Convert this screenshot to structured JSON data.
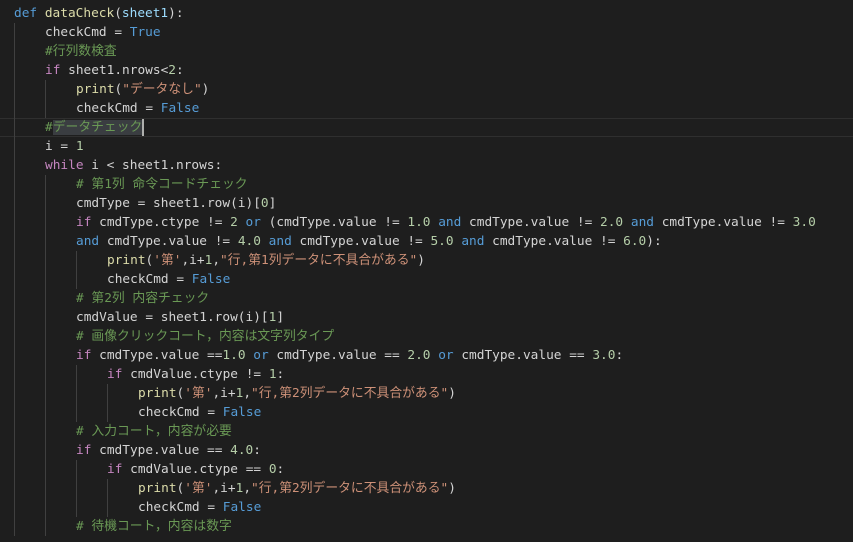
{
  "editor": {
    "theme_colors": {
      "background": "#1e1e1e",
      "keyword": "#569cd6",
      "control": "#c586c0",
      "function": "#dcdcaa",
      "parameter": "#9cdcfe",
      "string": "#ce9178",
      "number": "#b5cea8",
      "comment": "#6a9955",
      "text": "#d4d4d4"
    },
    "current_line": 7,
    "lines": [
      {
        "indent": 0,
        "tokens": [
          [
            "k",
            "def"
          ],
          [
            "t",
            " "
          ],
          [
            "f",
            "dataCheck"
          ],
          [
            "t",
            "("
          ],
          [
            "p",
            "sheet1"
          ],
          [
            "t",
            "):"
          ]
        ]
      },
      {
        "indent": 1,
        "tokens": [
          [
            "t",
            "checkCmd = "
          ],
          [
            "k",
            "True"
          ]
        ]
      },
      {
        "indent": 1,
        "tokens": [
          [
            "m",
            "#行列数検査"
          ]
        ]
      },
      {
        "indent": 1,
        "tokens": [
          [
            "c",
            "if"
          ],
          [
            "t",
            " sheet1.nrows<"
          ],
          [
            "n",
            "2"
          ],
          [
            "t",
            ":"
          ]
        ]
      },
      {
        "indent": 2,
        "tokens": [
          [
            "f",
            "print"
          ],
          [
            "t",
            "("
          ],
          [
            "s",
            "\"データなし\""
          ],
          [
            "t",
            ")"
          ]
        ]
      },
      {
        "indent": 2,
        "tokens": [
          [
            "t",
            "checkCmd = "
          ],
          [
            "k",
            "False"
          ]
        ]
      },
      {
        "indent": 1,
        "tokens": [
          [
            "m",
            "#"
          ],
          [
            "m sel",
            "データチェック"
          ]
        ],
        "cursor": true
      },
      {
        "indent": 1,
        "tokens": [
          [
            "t",
            "i = "
          ],
          [
            "n",
            "1"
          ]
        ]
      },
      {
        "indent": 1,
        "tokens": [
          [
            "c",
            "while"
          ],
          [
            "t",
            " i < sheet1.nrows:"
          ]
        ]
      },
      {
        "indent": 2,
        "tokens": [
          [
            "m",
            "# 第1列 命令コードチェック"
          ]
        ]
      },
      {
        "indent": 2,
        "tokens": [
          [
            "t",
            "cmdType = sheet1.row(i)["
          ],
          [
            "n",
            "0"
          ],
          [
            "t",
            "]"
          ]
        ]
      },
      {
        "indent": 2,
        "tokens": [
          [
            "c",
            "if"
          ],
          [
            "t",
            " cmdType.ctype != "
          ],
          [
            "n",
            "2"
          ],
          [
            "t",
            " "
          ],
          [
            "k",
            "or"
          ],
          [
            "t",
            " (cmdType.value != "
          ],
          [
            "n",
            "1.0"
          ],
          [
            "t",
            " "
          ],
          [
            "k",
            "and"
          ],
          [
            "t",
            " cmdType.value != "
          ],
          [
            "n",
            "2.0"
          ],
          [
            "t",
            " "
          ],
          [
            "k",
            "and"
          ],
          [
            "t",
            " cmdType.value != "
          ],
          [
            "n",
            "3.0"
          ]
        ]
      },
      {
        "indent": 2,
        "tokens": [
          [
            "k",
            "and"
          ],
          [
            "t",
            " cmdType.value != "
          ],
          [
            "n",
            "4.0"
          ],
          [
            "t",
            " "
          ],
          [
            "k",
            "and"
          ],
          [
            "t",
            " cmdType.value != "
          ],
          [
            "n",
            "5.0"
          ],
          [
            "t",
            " "
          ],
          [
            "k",
            "and"
          ],
          [
            "t",
            " cmdType.value != "
          ],
          [
            "n",
            "6.0"
          ],
          [
            "t",
            "):"
          ]
        ]
      },
      {
        "indent": 3,
        "tokens": [
          [
            "f",
            "print"
          ],
          [
            "t",
            "("
          ],
          [
            "s",
            "'第'"
          ],
          [
            "t",
            ",i+"
          ],
          [
            "n",
            "1"
          ],
          [
            "t",
            ","
          ],
          [
            "s",
            "\"行,第1列データに不具合がある\""
          ],
          [
            "t",
            ")"
          ]
        ]
      },
      {
        "indent": 3,
        "tokens": [
          [
            "t",
            "checkCmd = "
          ],
          [
            "k",
            "False"
          ]
        ]
      },
      {
        "indent": 2,
        "tokens": [
          [
            "m",
            "# 第2列 内容チェック"
          ]
        ]
      },
      {
        "indent": 2,
        "tokens": [
          [
            "t",
            "cmdValue = sheet1.row(i)["
          ],
          [
            "n",
            "1"
          ],
          [
            "t",
            "]"
          ]
        ]
      },
      {
        "indent": 2,
        "tokens": [
          [
            "m",
            "# 画像クリックコート，内容は文字列タイプ"
          ]
        ]
      },
      {
        "indent": 2,
        "tokens": [
          [
            "c",
            "if"
          ],
          [
            "t",
            " cmdType.value =="
          ],
          [
            "n",
            "1.0"
          ],
          [
            "t",
            " "
          ],
          [
            "k",
            "or"
          ],
          [
            "t",
            " cmdType.value == "
          ],
          [
            "n",
            "2.0"
          ],
          [
            "t",
            " "
          ],
          [
            "k",
            "or"
          ],
          [
            "t",
            " cmdType.value == "
          ],
          [
            "n",
            "3.0"
          ],
          [
            "t",
            ":"
          ]
        ]
      },
      {
        "indent": 3,
        "tokens": [
          [
            "c",
            "if"
          ],
          [
            "t",
            " cmdValue.ctype != "
          ],
          [
            "n",
            "1"
          ],
          [
            "t",
            ":"
          ]
        ]
      },
      {
        "indent": 4,
        "tokens": [
          [
            "f",
            "print"
          ],
          [
            "t",
            "("
          ],
          [
            "s",
            "'第'"
          ],
          [
            "t",
            ",i+"
          ],
          [
            "n",
            "1"
          ],
          [
            "t",
            ","
          ],
          [
            "s",
            "\"行,第2列データに不具合がある\""
          ],
          [
            "t",
            ")"
          ]
        ]
      },
      {
        "indent": 4,
        "tokens": [
          [
            "t",
            "checkCmd = "
          ],
          [
            "k",
            "False"
          ]
        ]
      },
      {
        "indent": 2,
        "tokens": [
          [
            "m",
            "# 入力コート，内容が必要"
          ]
        ]
      },
      {
        "indent": 2,
        "tokens": [
          [
            "c",
            "if"
          ],
          [
            "t",
            " cmdType.value == "
          ],
          [
            "n",
            "4.0"
          ],
          [
            "t",
            ":"
          ]
        ]
      },
      {
        "indent": 3,
        "tokens": [
          [
            "c",
            "if"
          ],
          [
            "t",
            " cmdValue.ctype == "
          ],
          [
            "n",
            "0"
          ],
          [
            "t",
            ":"
          ]
        ]
      },
      {
        "indent": 4,
        "tokens": [
          [
            "f",
            "print"
          ],
          [
            "t",
            "("
          ],
          [
            "s",
            "'第'"
          ],
          [
            "t",
            ",i+"
          ],
          [
            "n",
            "1"
          ],
          [
            "t",
            ","
          ],
          [
            "s",
            "\"行,第2列データに不具合がある\""
          ],
          [
            "t",
            ")"
          ]
        ]
      },
      {
        "indent": 4,
        "tokens": [
          [
            "t",
            "checkCmd = "
          ],
          [
            "k",
            "False"
          ]
        ]
      },
      {
        "indent": 2,
        "tokens": [
          [
            "m",
            "# 待機コート，内容は数字"
          ]
        ]
      }
    ]
  }
}
